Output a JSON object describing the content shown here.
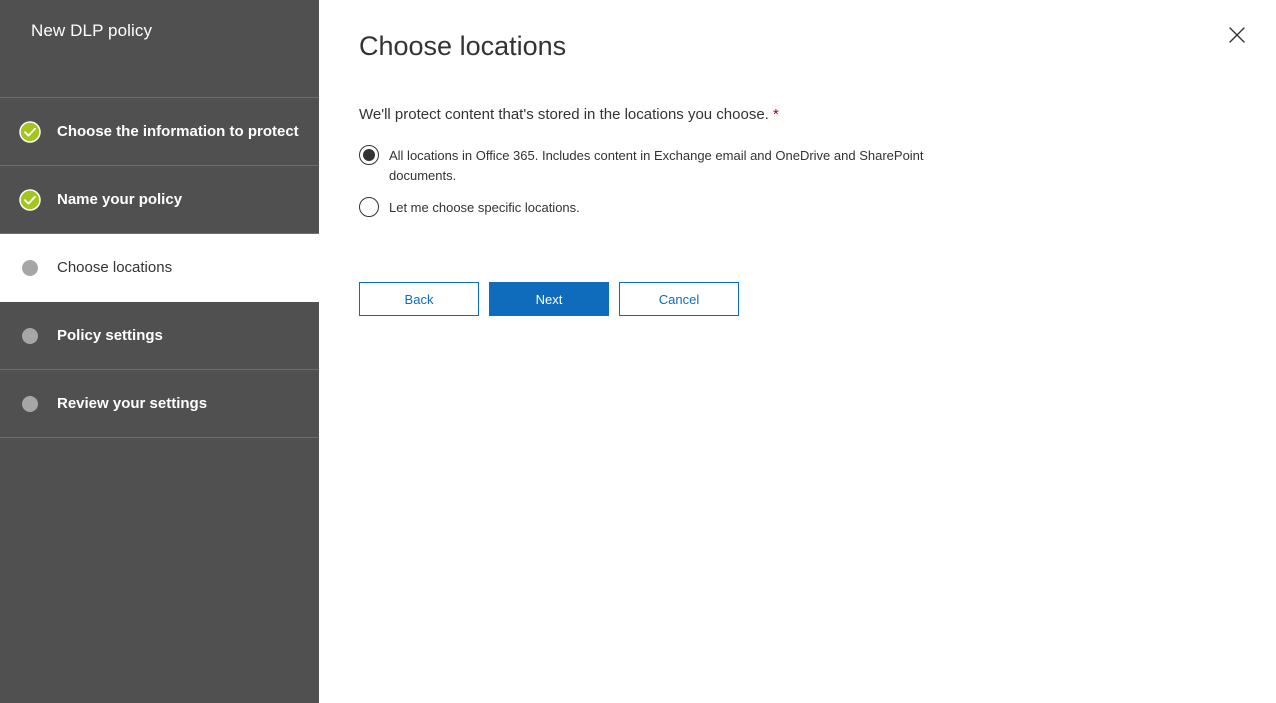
{
  "sidebar": {
    "title": "New DLP policy",
    "steps": [
      {
        "label": "Choose the information to protect",
        "state": "complete"
      },
      {
        "label": "Name your policy",
        "state": "complete"
      },
      {
        "label": "Choose locations",
        "state": "current"
      },
      {
        "label": "Policy settings",
        "state": "pending"
      },
      {
        "label": "Review your settings",
        "state": "pending"
      }
    ]
  },
  "main": {
    "title": "Choose locations",
    "question": "We'll protect content that's stored in the locations you choose.",
    "required_mark": "*",
    "options": [
      {
        "label": "All locations in Office 365. Includes content in Exchange email and OneDrive and SharePoint documents.",
        "selected": true
      },
      {
        "label": "Let me choose specific locations.",
        "selected": false
      }
    ],
    "buttons": {
      "back": "Back",
      "next": "Next",
      "cancel": "Cancel"
    }
  },
  "colors": {
    "sidebar_bg": "#505050",
    "check_green": "#a4c61a",
    "primary_blue": "#0f6cbd",
    "required_red": "#a80000"
  },
  "icons": {
    "close": "close-icon",
    "step_complete": "checkmark-circle-icon",
    "step_pending": "dot-icon"
  }
}
